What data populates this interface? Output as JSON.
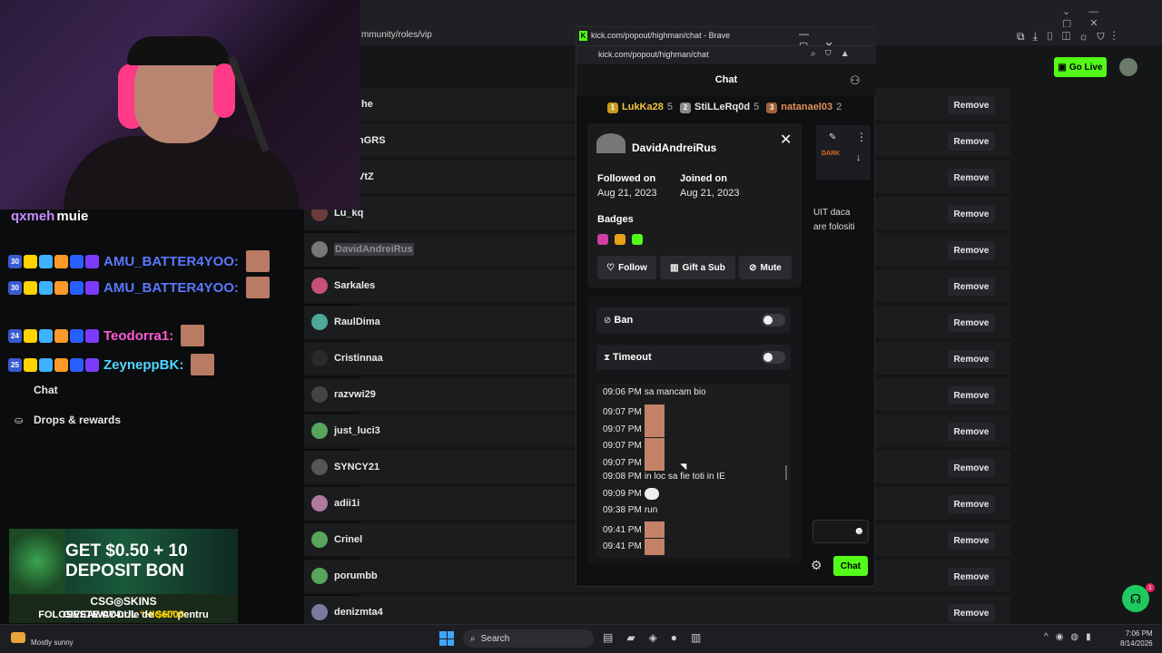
{
  "browser": {
    "address": "mmunity/roles/vip",
    "go_live": "Go Live"
  },
  "vip_list": {
    "remove_label": "Remove",
    "rows": [
      {
        "name": "he",
        "color": "#c9a227"
      },
      {
        "name": "nGRS",
        "color": "#58a55c"
      },
      {
        "name": "VtZ",
        "color": "#58a55c"
      },
      {
        "name": "Lu_kq",
        "color": "#6c3b3b"
      },
      {
        "name": "DavidAndreiRus",
        "color": "#777777",
        "highlight": true
      },
      {
        "name": "Sarkales",
        "color": "#c84f7a"
      },
      {
        "name": "RaulDima",
        "color": "#4fa89a"
      },
      {
        "name": "Cristinnaa",
        "color": "#2a2a2a"
      },
      {
        "name": "razvwi29",
        "color": "#444444"
      },
      {
        "name": "just_luci3",
        "color": "#58a55c"
      },
      {
        "name": "SYNCY21",
        "color": "#555555"
      },
      {
        "name": "adii1i",
        "color": "#b07aa0"
      },
      {
        "name": "Crinel",
        "color": "#58a55c"
      },
      {
        "name": "porumbb",
        "color": "#58a55c"
      },
      {
        "name": "denizmta4",
        "color": "#7a7aa0"
      }
    ]
  },
  "overlay_chat": {
    "lines": [
      {
        "user": "qxmeh",
        "suffix": "muie",
        "color": "#c98bff"
      },
      {
        "user": "AMU_BATTER4YOO:",
        "color": "#5a78ff",
        "badges": [
          "30"
        ]
      },
      {
        "user": "AMU_BATTER4YOO:",
        "color": "#5a78ff",
        "badges": [
          "30"
        ]
      },
      {
        "user": "Teodorra1:",
        "color": "#ff5ad2",
        "badges": [
          "24"
        ]
      },
      {
        "user": "ZeyneppBK:",
        "color": "#4fd7ff",
        "badges": [
          "25"
        ]
      }
    ]
  },
  "sidebar": {
    "chat": "Chat",
    "drops": "Drops & rewards"
  },
  "ad": {
    "line1": "GET $0.50 + 10",
    "line2": "DEPOSIT BON",
    "brand": "CSG◎SKINS",
    "code_pre": "FOLOSESTE CODUL ",
    "code": "“HIGH”",
    "code_post": " pentru",
    "giveaway_pre": "GIVEAWAY-urile de ",
    "giveaway_amount": "$6000"
  },
  "popup": {
    "window_title": "kick.com/popout/highman/chat - Brave",
    "url": "kick.com/popout/highman/chat",
    "chat_title": "Chat",
    "gifters": [
      {
        "rank": "1",
        "name": "LukKa28",
        "count": "5",
        "color": "#f5c242"
      },
      {
        "rank": "2",
        "name": "StiLLeRq0d",
        "count": "5",
        "color": "#e8e8e8"
      },
      {
        "rank": "3",
        "name": "natanael03",
        "count": "2",
        "color": "#e0905a"
      }
    ],
    "pinned_badge": "DARK",
    "side_text1": "UIT daca",
    "side_text2": "are folositi",
    "chat_button": "Chat"
  },
  "user_card": {
    "username": "DavidAndreiRus",
    "followed_label": "Followed on",
    "followed_date": "Aug 21, 2023",
    "joined_label": "Joined on",
    "joined_date": "Aug 21, 2023",
    "badges_label": "Badges",
    "follow": "Follow",
    "gift": "Gift a Sub",
    "mute": "Mute"
  },
  "moderation": {
    "ban": "Ban",
    "timeout": "Timeout",
    "history": [
      {
        "time": "09:06 PM",
        "text": "sa mancam bio",
        "emote": false
      },
      {
        "time": "09:07 PM",
        "text": "",
        "emote": true
      },
      {
        "time": "09:07 PM",
        "text": "",
        "emote": true
      },
      {
        "time": "09:07 PM",
        "text": "",
        "emote": true
      },
      {
        "time": "09:07 PM",
        "text": "",
        "emote": true
      },
      {
        "time": "09:08 PM",
        "text": "in loc sa fie toti in IE",
        "emote": false
      },
      {
        "time": "09:09 PM",
        "text": "",
        "emote": "bubble"
      },
      {
        "time": "09:38 PM",
        "text": "run",
        "emote": false
      },
      {
        "time": "09:41 PM",
        "text": "",
        "emote": true
      },
      {
        "time": "09:41 PM",
        "text": "",
        "emote": true
      }
    ]
  },
  "taskbar": {
    "weather": "Mostly sunny",
    "search": "Search",
    "time": "7:06 PM",
    "date": "8/14/2026",
    "support_badge": "1"
  }
}
